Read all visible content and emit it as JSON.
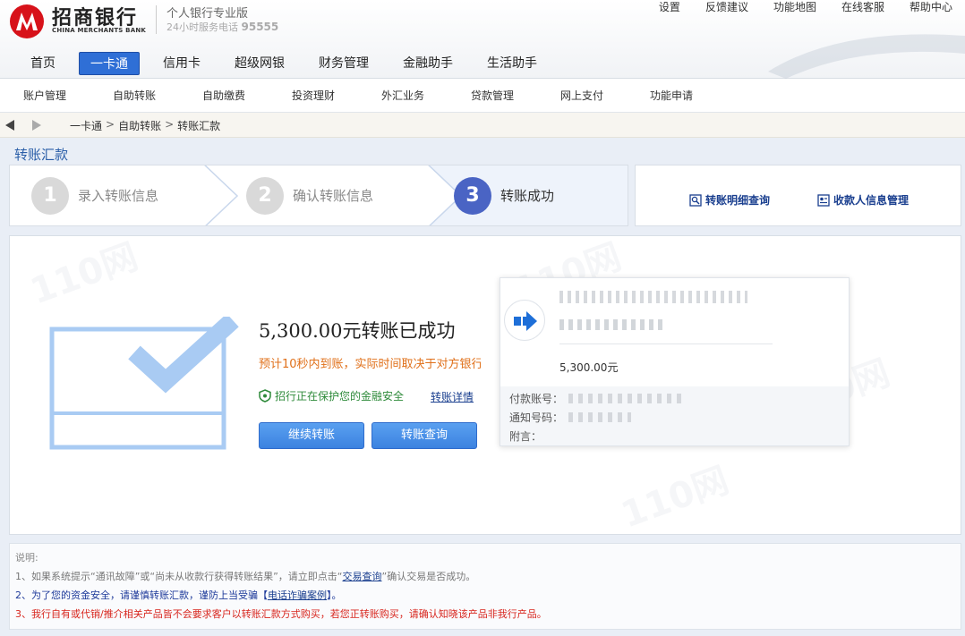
{
  "header": {
    "brand_name": "招商银行",
    "brand_en": "CHINA MERCHANTS BANK",
    "edition": "个人银行专业版",
    "hotline_label": "24小时服务电话",
    "hotline_number": "95555",
    "top_links": [
      "设置",
      "反馈建议",
      "功能地图",
      "在线客服",
      "帮助中心"
    ]
  },
  "main_nav": [
    "首页",
    "一卡通",
    "信用卡",
    "超级网银",
    "财务管理",
    "金融助手",
    "生活助手"
  ],
  "main_nav_active": "一卡通",
  "sub_nav": [
    "账户管理",
    "自助转账",
    "自助缴费",
    "投资理财",
    "外汇业务",
    "贷款管理",
    "网上支付",
    "功能申请"
  ],
  "breadcrumb": [
    "一卡通",
    "自助转账",
    "转账汇款"
  ],
  "page_title": "转账汇款",
  "steps": [
    {
      "num": "1",
      "label": "录入转账信息"
    },
    {
      "num": "2",
      "label": "确认转账信息"
    },
    {
      "num": "3",
      "label": "转账成功"
    }
  ],
  "active_step": 3,
  "quick_links": {
    "detail_query": "转账明细查询",
    "payee_manage": "收款人信息管理"
  },
  "result": {
    "title": "5,300.00元转账已成功",
    "arrival_note": "预计10秒内到账，实际时间取决于对方银行",
    "security_note": "招行正在保护您的金融安全",
    "detail_link": "转账详情",
    "continue_button": "继续转账",
    "query_button": "转账查询"
  },
  "receipt": {
    "amount": "5,300.00元",
    "payer_account_label": "付款账号：",
    "notice_number_label": "通知号码：",
    "memo_label": "附言："
  },
  "notes": {
    "heading": "说明:",
    "note1_pre": "1、如果系统提示“通讯故障”或“尚未从收款行获得转账结果”，请立即点击“",
    "note1_link": "交易查询",
    "note1_post": "”确认交易是否成功。",
    "note2_pre": "2、为了您的资金安全，请谨慎转账汇款，谨防上当受骗【",
    "note2_link": "电话诈骗案例",
    "note2_post": "】。",
    "note3": "3、我行自有或代销/推介相关产品皆不会要求客户以转账汇款方式购买，若您正转账购买，请确认知晓该产品非我行产品。"
  },
  "colors": {
    "accent_blue": "#2f6fd6",
    "step_active": "#4a64c4",
    "success_orange": "#e0701a",
    "warning_red": "#d8261e"
  }
}
